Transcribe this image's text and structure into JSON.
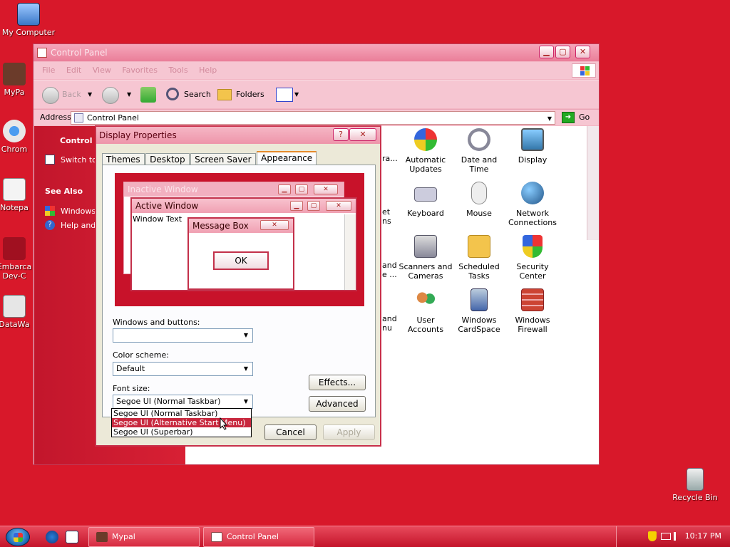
{
  "desktop": {
    "icons": [
      {
        "label": "My Computer"
      },
      {
        "label": "MyPa"
      },
      {
        "label": "Chrom"
      },
      {
        "label": "Notepa"
      },
      {
        "label": "Embarca"
      },
      {
        "label": "Dev-C"
      },
      {
        "label": "DataWa"
      },
      {
        "label": "Recycle Bin"
      }
    ]
  },
  "control_panel": {
    "title": "Control Panel",
    "menu": [
      "File",
      "Edit",
      "View",
      "Favorites",
      "Tools",
      "Help"
    ],
    "toolbar": {
      "back": "Back",
      "search": "Search",
      "folders": "Folders"
    },
    "address": {
      "label": "Address",
      "value": "Control Panel",
      "go": "Go"
    },
    "left_pane": {
      "heading": "Control P",
      "switch": "Switch to",
      "see_also": "See Also",
      "windows": "Windows",
      "help": "Help and"
    },
    "clipped_labels": [
      "ra...",
      "and",
      "e ...",
      "and",
      "nu",
      "et",
      "ns"
    ],
    "items": [
      {
        "label1": "Automatic",
        "label2": "Updates"
      },
      {
        "label1": "Date and",
        "label2": "Time"
      },
      {
        "label1": "Display",
        "label2": ""
      },
      {
        "label1": "Keyboard",
        "label2": ""
      },
      {
        "label1": "Mouse",
        "label2": ""
      },
      {
        "label1": "Network",
        "label2": "Connections"
      },
      {
        "label1": "Scanners and",
        "label2": "Cameras"
      },
      {
        "label1": "Scheduled",
        "label2": "Tasks"
      },
      {
        "label1": "Security",
        "label2": "Center"
      },
      {
        "label1": "User",
        "label2": "Accounts"
      },
      {
        "label1": "Windows",
        "label2": "CardSpace"
      },
      {
        "label1": "Windows",
        "label2": "Firewall"
      }
    ]
  },
  "dialog": {
    "title": "Display Properties",
    "help_btn": "?",
    "close_btn": "✕",
    "tabs": [
      "Themes",
      "Desktop",
      "Screen Saver",
      "Appearance"
    ],
    "preview": {
      "inactive": "Inactive Window",
      "active": "Active Window",
      "window_text": "Window Text",
      "message_box": "Message Box",
      "ok": "OK"
    },
    "windows_buttons_label": "Windows and buttons:",
    "windows_buttons_value": "",
    "color_scheme_label": "Color scheme:",
    "color_scheme_value": "Default",
    "font_size_label": "Font size:",
    "font_size_value": "Segoe UI (Normal Taskbar)",
    "font_options": [
      "Segoe UI (Normal Taskbar)",
      "Segoe UI (Alternative Start Menu)",
      "Segoe UI (Superbar)"
    ],
    "effects": "Effects...",
    "advanced": "Advanced",
    "cancel": "Cancel",
    "apply": "Apply"
  },
  "taskbar": {
    "tasks": [
      "Mypal",
      "Control Panel"
    ],
    "clock": "10:17 PM"
  }
}
